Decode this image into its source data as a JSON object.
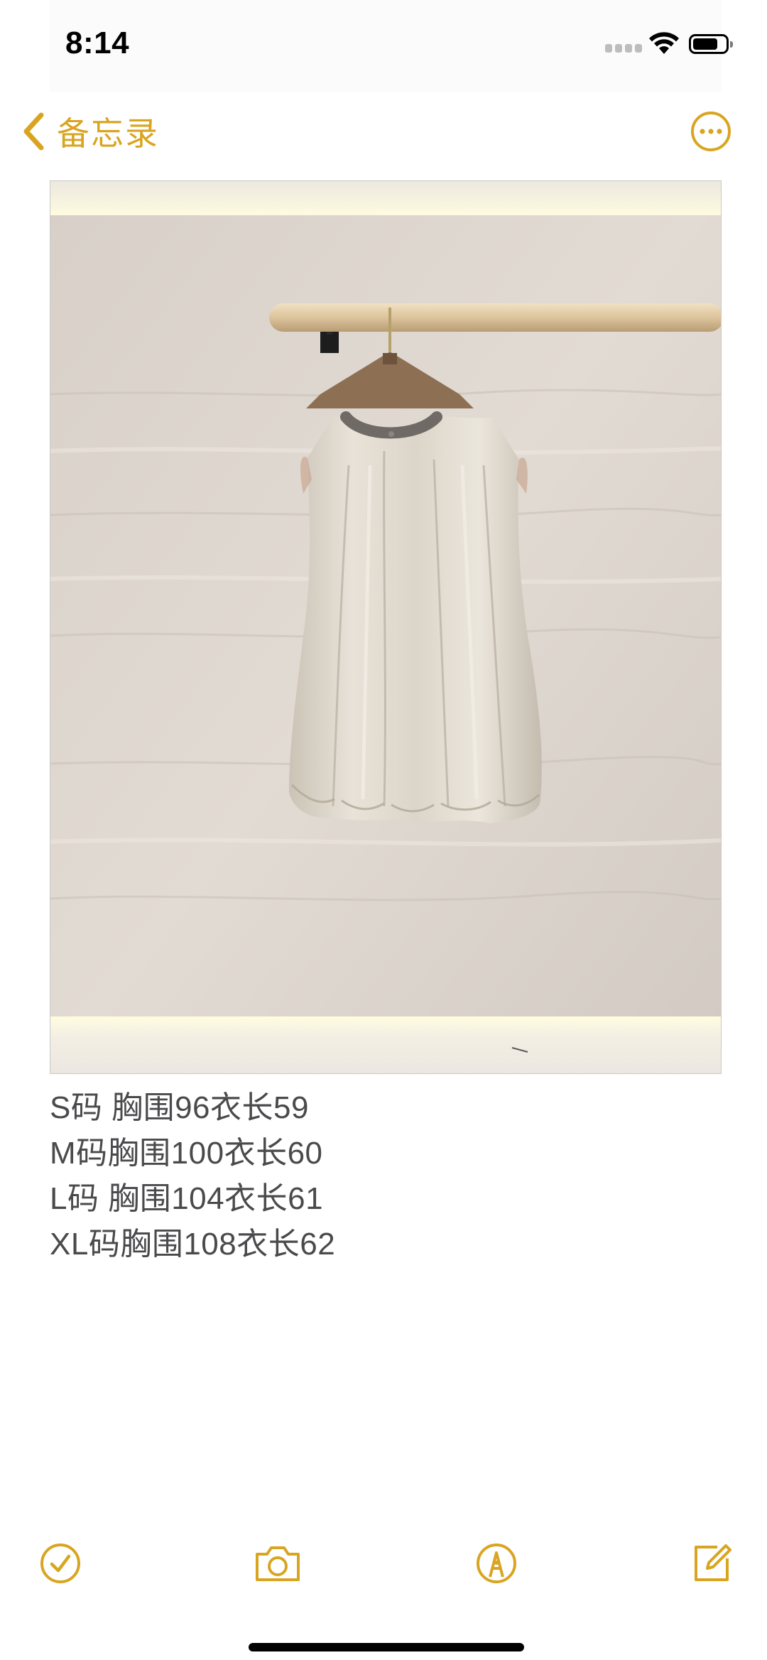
{
  "status_bar": {
    "time": "8:14"
  },
  "nav": {
    "back_label": "备忘录",
    "back_icon": "chevron-left-icon",
    "more_icon": "ellipsis-circle-icon"
  },
  "note": {
    "lines": [
      "S码 胸围96衣长59",
      "M码胸围100衣长60",
      "L码 胸围104衣长61",
      "XL码胸围108衣长62"
    ]
  },
  "toolbar": {
    "items": [
      {
        "icon": "checklist-icon"
      },
      {
        "icon": "camera-icon"
      },
      {
        "icon": "markup-pen-icon"
      },
      {
        "icon": "compose-icon"
      }
    ]
  },
  "colors": {
    "accent": "#d9a521",
    "text": "#4a4a4c"
  }
}
